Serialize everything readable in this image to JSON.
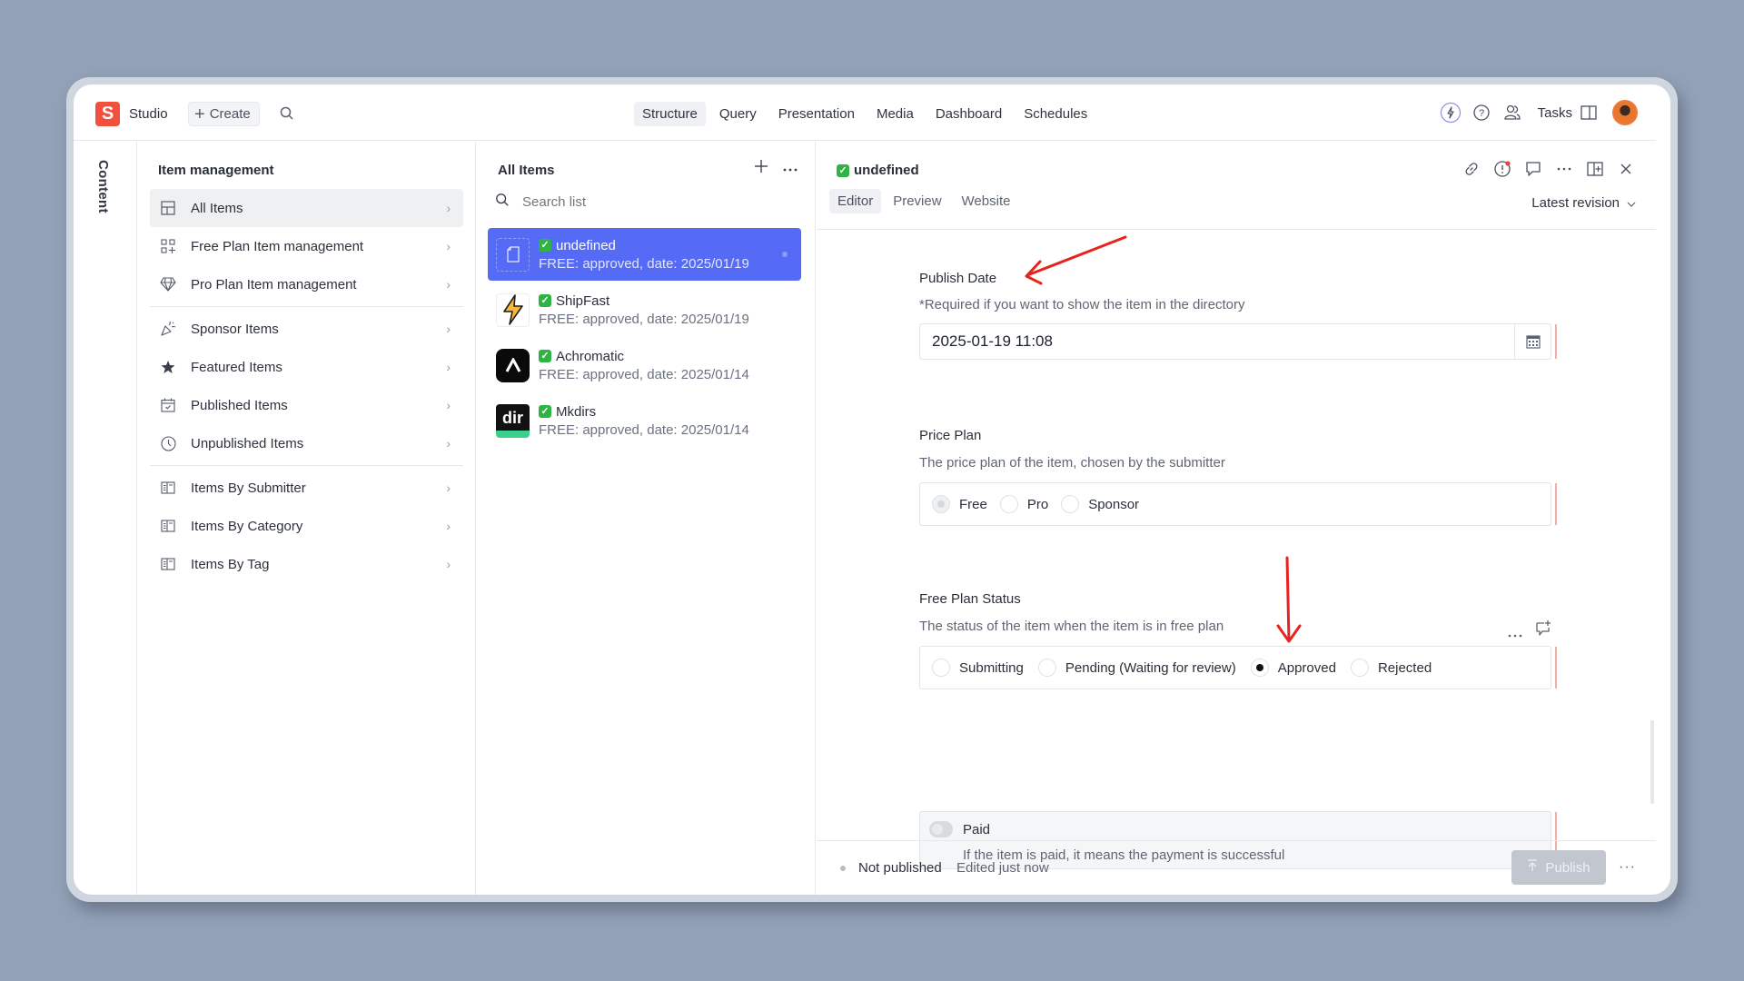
{
  "app": {
    "logo_letter": "S",
    "name": "Studio",
    "create_label": "Create"
  },
  "nav": {
    "items": [
      "Structure",
      "Query",
      "Presentation",
      "Media",
      "Dashboard",
      "Schedules"
    ],
    "active": "Structure"
  },
  "top_right": {
    "tasks_label": "Tasks"
  },
  "rail": {
    "label": "Content"
  },
  "structure": {
    "title": "Item management",
    "items": [
      {
        "label": "All Items",
        "icon": "grid-layout-icon",
        "active": true
      },
      {
        "label": "Free Plan Item management",
        "icon": "add-grid-icon"
      },
      {
        "label": "Pro Plan Item management",
        "icon": "diamond-icon"
      },
      {
        "label": "Sponsor Items",
        "icon": "party-popper-icon"
      },
      {
        "label": "Featured Items",
        "icon": "star-icon"
      },
      {
        "label": "Published Items",
        "icon": "calendar-check-icon"
      },
      {
        "label": "Unpublished Items",
        "icon": "clock-icon"
      },
      {
        "label": "Items By Submitter",
        "icon": "list-panel-icon"
      },
      {
        "label": "Items By Category",
        "icon": "list-panel-icon"
      },
      {
        "label": "Items By Tag",
        "icon": "list-panel-icon"
      }
    ]
  },
  "list": {
    "title": "All Items",
    "search_placeholder": "Search list",
    "items": [
      {
        "title": "undefined",
        "subtitle": "FREE: approved, date: 2025/01/19",
        "selected": true
      },
      {
        "title": "ShipFast",
        "subtitle": "FREE: approved, date: 2025/01/19"
      },
      {
        "title": "Achromatic",
        "subtitle": "FREE: approved, date: 2025/01/14"
      },
      {
        "title": "Mkdirs",
        "subtitle": "FREE: approved, date: 2025/01/14",
        "thumb_text": "dir"
      }
    ]
  },
  "editor": {
    "title": "undefined",
    "tabs": [
      "Editor",
      "Preview",
      "Website"
    ],
    "active_tab": "Editor",
    "revision": "Latest revision",
    "fields": {
      "publish_date": {
        "label": "Publish Date",
        "description": "*Required if you want to show the item in the directory",
        "value": "2025-01-19 11:08"
      },
      "price_plan": {
        "label": "Price Plan",
        "description": "The price plan of the item, chosen by the submitter",
        "options": [
          "Free",
          "Pro",
          "Sponsor"
        ],
        "selected": "Free"
      },
      "free_plan_status": {
        "label": "Free Plan Status",
        "description": "The status of the item when the item is in free plan",
        "options": [
          "Submitting",
          "Pending (Waiting for review)",
          "Approved",
          "Rejected"
        ],
        "selected": "Approved"
      },
      "paid": {
        "label": "Paid",
        "description": "If the item is paid, it means the payment is successful",
        "value": false
      }
    },
    "footer": {
      "status": "Not published",
      "edited": "Edited just now",
      "publish_label": "Publish"
    }
  },
  "colors": {
    "accent": "#556bf5",
    "logo": "#f0503c",
    "check": "#2fb344",
    "annotation": "#e8231f"
  }
}
